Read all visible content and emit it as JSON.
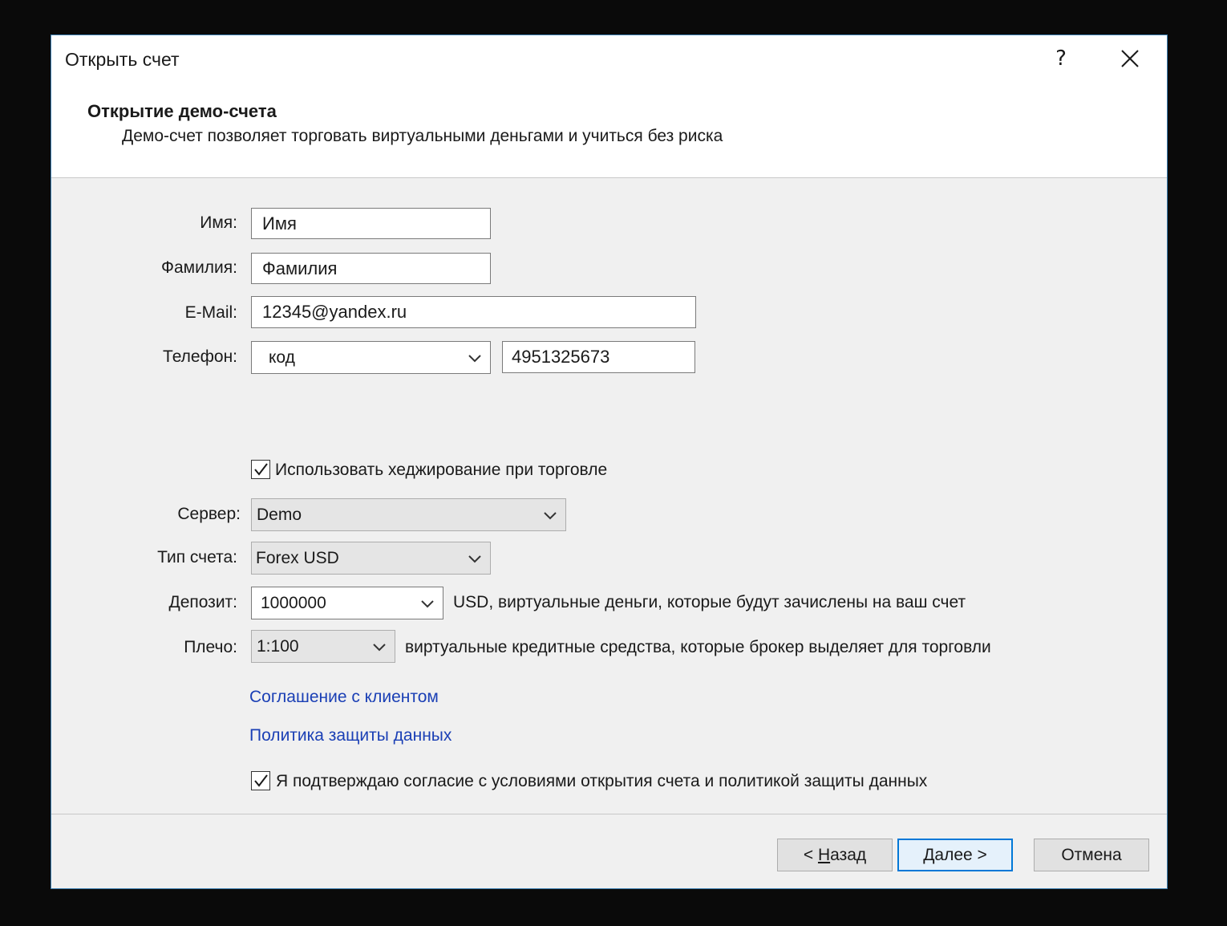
{
  "window": {
    "title": "Открыть счет",
    "help_label": "?"
  },
  "header": {
    "heading": "Открытие демо-счета",
    "subheading": "Демо-счет позволяет торговать виртуальными деньгами и учиться без риска"
  },
  "form": {
    "first_name": {
      "label": "Имя:",
      "value": "Имя"
    },
    "last_name": {
      "label": "Фамилия:",
      "value": "Фамилия"
    },
    "email": {
      "label": "E-Mail:",
      "value": "12345@yandex.ru"
    },
    "phone": {
      "label": "Телефон:",
      "code_value": "код",
      "number_value": "4951325673"
    },
    "hedging": {
      "checked": true,
      "label": "Использовать хеджирование при торговле"
    },
    "server": {
      "label": "Сервер:",
      "value": "Demo"
    },
    "account_type": {
      "label": "Тип счета:",
      "value": "Forex USD"
    },
    "deposit": {
      "label": "Депозит:",
      "value": "1000000",
      "hint": "USD, виртуальные деньги, которые будут зачислены на ваш счет"
    },
    "leverage": {
      "label": "Плечо:",
      "value": "1:100",
      "hint": "виртуальные кредитные средства, которые брокер выделяет для торговли"
    }
  },
  "links": {
    "agreement": "Соглашение с клиентом",
    "privacy": "Политика защиты данных"
  },
  "consent": {
    "checked": true,
    "label": "Я подтверждаю согласие с условиями открытия счета и политикой защиты данных"
  },
  "buttons": {
    "back_prefix": "< ",
    "back_accel": "Н",
    "back_rest": "азад",
    "next_accel": "Д",
    "next_rest": "алее >",
    "cancel": "Отмена"
  },
  "colors": {
    "link": "#1a3fb5",
    "accent": "#0078d7",
    "dialog_bg": "#f0f0f0",
    "header_bg": "#ffffff"
  }
}
